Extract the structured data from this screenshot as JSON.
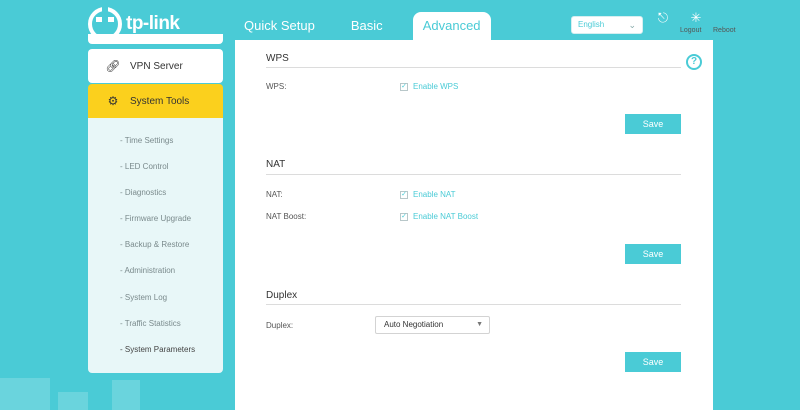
{
  "header": {
    "brand": "tp-link",
    "tabs": [
      {
        "label": "Quick Setup"
      },
      {
        "label": "Basic"
      },
      {
        "label": "Advanced",
        "active": true
      }
    ],
    "language": "English",
    "logout_label": "Logout",
    "reboot_label": "Reboot"
  },
  "sidebar": {
    "items": [
      {
        "label": "VPN Server",
        "icon": "link-icon"
      },
      {
        "label": "System Tools",
        "icon": "gear-icon",
        "active": true
      }
    ],
    "subitems": [
      {
        "label": "- Time Settings"
      },
      {
        "label": "- LED Control"
      },
      {
        "label": "- Diagnostics"
      },
      {
        "label": "- Firmware Upgrade"
      },
      {
        "label": "- Backup & Restore"
      },
      {
        "label": "- Administration"
      },
      {
        "label": "- System Log"
      },
      {
        "label": "- Traffic Statistics"
      },
      {
        "label": "- System Parameters",
        "active": true
      }
    ]
  },
  "main": {
    "help_icon": "?",
    "wps": {
      "title": "WPS",
      "field_label": "WPS:",
      "checkbox_label": "Enable WPS",
      "checked": true,
      "save_label": "Save"
    },
    "nat": {
      "title": "NAT",
      "nat_label": "NAT:",
      "nat_checkbox": "Enable NAT",
      "boost_label": "NAT Boost:",
      "boost_checkbox": "Enable NAT Boost",
      "save_label": "Save"
    },
    "duplex": {
      "title": "Duplex",
      "field_label": "Duplex:",
      "selected": "Auto Negotiation",
      "save_label": "Save"
    }
  },
  "colors": {
    "accent": "#4acbd6",
    "active_menu": "#fbd01d"
  }
}
